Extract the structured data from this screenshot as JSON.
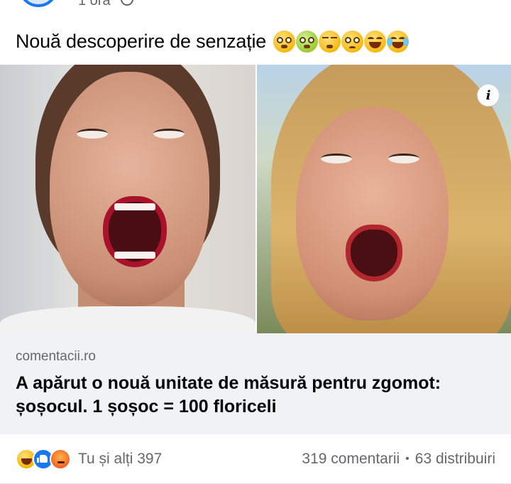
{
  "header": {
    "time": "1 oră"
  },
  "post": {
    "caption": "Nouă descoperire de senzație",
    "caption_emojis": [
      "flushed-face",
      "nauseated-face",
      "relieved-face",
      "worried-face",
      "tired-face",
      "tears-of-joy-face"
    ]
  },
  "link_preview": {
    "domain": "comentacii.ro",
    "title": "A apărut o nouă unitate de măsură pentru zgomot: șoșocul. 1 șoșoc = 100 floriceli",
    "info_symbol": "i"
  },
  "footer": {
    "reactions": [
      "haha",
      "like",
      "angry"
    ],
    "reaction_text": "Tu și alți 397",
    "comments": "319 comentarii",
    "separator": "•",
    "shares": "63 distribuiri"
  },
  "colors": {
    "link_background": "#f0f2f5",
    "secondary_text": "#65676b",
    "like_blue": "#1877f2"
  }
}
